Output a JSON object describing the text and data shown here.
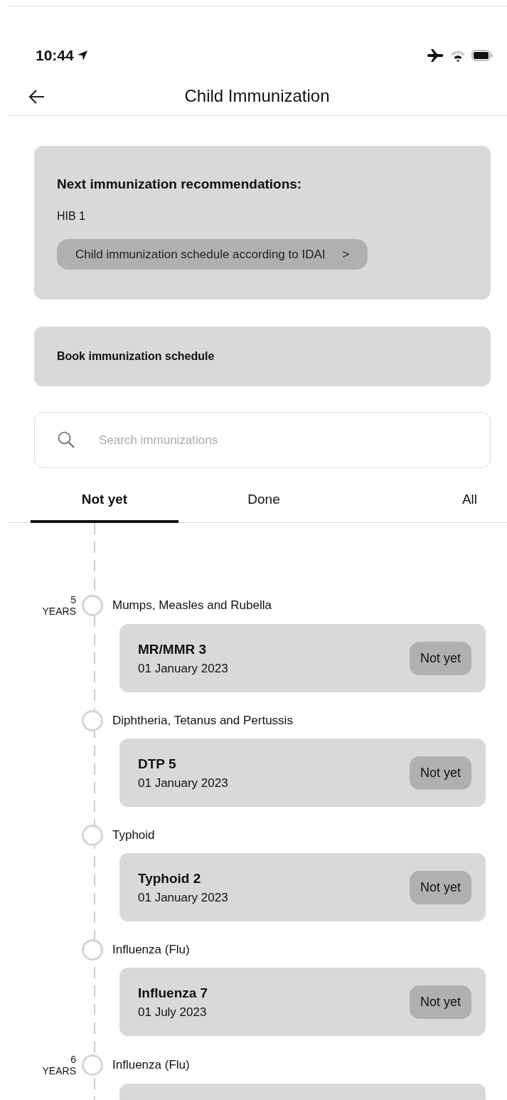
{
  "status_bar": {
    "time": "10:44"
  },
  "header": {
    "title": "Child Immunization"
  },
  "recommendation": {
    "title": "Next immunization recommendations:",
    "vaccine": "HIB 1",
    "link": "Child immunization schedule according to IDAI",
    "link_arrow": ">"
  },
  "book": {
    "label": "Book immunization schedule"
  },
  "search": {
    "placeholder": "Search immunizations"
  },
  "tabs": [
    {
      "label": "Not yet",
      "selected": true
    },
    {
      "label": "Done",
      "selected": false
    },
    {
      "label": "All",
      "selected": false
    }
  ],
  "timeline": [
    {
      "age": "5",
      "unit": "YEARS",
      "items": [
        {
          "category": "Mumps, Measles and Rubella",
          "vaccine": "MR/MMR 3",
          "date": "01 January 2023",
          "status": "Not yet"
        },
        {
          "category": "Diphtheria, Tetanus and Pertussis",
          "vaccine": "DTP 5",
          "date": "01 January 2023",
          "status": "Not yet"
        },
        {
          "category": "Typhoid",
          "vaccine": "Typhoid 2",
          "date": "01 January 2023",
          "status": "Not yet"
        },
        {
          "category": "Influenza (Flu)",
          "vaccine": "Influenza 7",
          "date": "01 July 2023",
          "status": "Not yet"
        }
      ]
    },
    {
      "age": "6",
      "unit": "YEARS",
      "items": [
        {
          "category": "Influenza (Flu)"
        }
      ]
    }
  ]
}
